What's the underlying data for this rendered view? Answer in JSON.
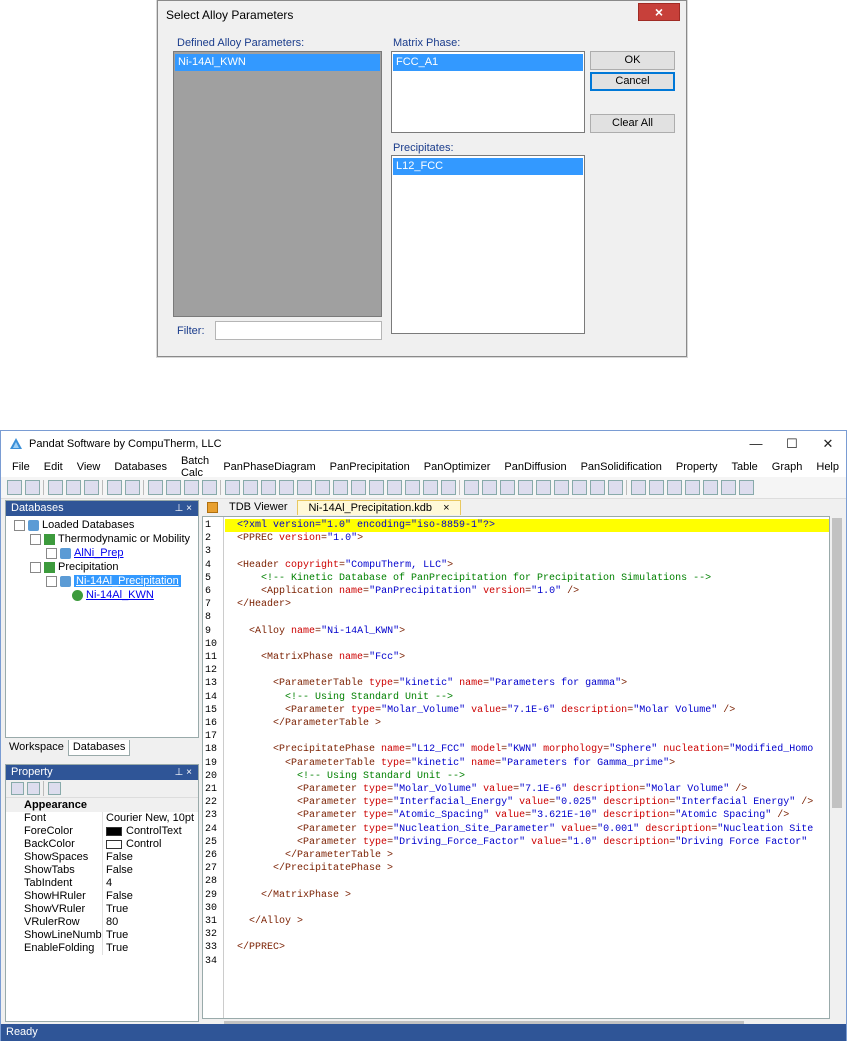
{
  "dialog": {
    "title": "Select Alloy Parameters",
    "close_glyph": "×",
    "defined_label": "Defined Alloy Parameters:",
    "defined_items": [
      "Ni-14Al_KWN"
    ],
    "matrix_label": "Matrix Phase:",
    "matrix_items": [
      "FCC_A1"
    ],
    "precip_label": "Precipitates:",
    "precip_items": [
      "L12_FCC"
    ],
    "filter_label": "Filter:",
    "filter_value": "",
    "ok_label": "OK",
    "cancel_label": "Cancel",
    "clear_label": "Clear All"
  },
  "window": {
    "title": "Pandat Software by CompuTherm, LLC",
    "minimize": "—",
    "maximize": "☐",
    "close": "✕",
    "menu": [
      "File",
      "Edit",
      "View",
      "Databases",
      "Batch Calc",
      "PanPhaseDiagram",
      "PanPrecipitation",
      "PanOptimizer",
      "PanDiffusion",
      "PanSolidification",
      "Property",
      "Table",
      "Graph",
      "Help"
    ]
  },
  "databases_panel": {
    "title": "Databases",
    "pin": "⊥ ×",
    "tree": {
      "root": "Loaded Databases",
      "thermo": "Thermodynamic or Mobility",
      "thermo_child": "AlNi_Prep",
      "precip": "Precipitation",
      "precip_child": "Ni-14Al_Precipitation",
      "precip_grandchild": "Ni-14Al_KWN"
    },
    "tabs": [
      "Workspace",
      "Databases"
    ]
  },
  "property_panel": {
    "title": "Property",
    "pin": "⊥ ×",
    "category": "Appearance",
    "rows": [
      {
        "name": "Font",
        "value": "Courier New, 10pt"
      },
      {
        "name": "ForeColor",
        "value": "ControlText"
      },
      {
        "name": "BackColor",
        "value": "Control"
      },
      {
        "name": "ShowSpaces",
        "value": "False"
      },
      {
        "name": "ShowTabs",
        "value": "False"
      },
      {
        "name": "TabIndent",
        "value": "4"
      },
      {
        "name": "ShowHRuler",
        "value": "False"
      },
      {
        "name": "ShowVRuler",
        "value": "True"
      },
      {
        "name": "VRulerRow",
        "value": "80"
      },
      {
        "name": "ShowLineNumbe",
        "value": "True"
      },
      {
        "name": "EnableFolding",
        "value": "True"
      }
    ]
  },
  "editor": {
    "tabs": [
      "TDB Viewer",
      "Ni-14Al_Precipitation.kdb"
    ],
    "lines": [
      "<?xml version=\"1.0\" encoding=\"iso-8859-1\"?>",
      "<PPREC version=\"1.0\">",
      "",
      "<Header copyright=\"CompuTherm, LLC\">",
      "    <!-- Kinetic Database of PanPrecipitation for Precipitation Simulations -->",
      "    <Application name=\"PanPrecipitation\" version=\"1.0\" />",
      "</Header>",
      "",
      "  <Alloy name=\"Ni-14Al_KWN\">",
      "",
      "    <MatrixPhase name=\"Fcc\">",
      "",
      "      <ParameterTable type=\"kinetic\" name=\"Parameters for gamma\">",
      "        <!-- Using Standard Unit -->",
      "        <Parameter type=\"Molar_Volume\" value=\"7.1E-6\" description=\"Molar Volume\" />",
      "      </ParameterTable >",
      "",
      "      <PrecipitatePhase name=\"L12_FCC\" model=\"KWN\" morphology=\"Sphere\" nucleation=\"Modified_Homo",
      "        <ParameterTable type=\"kinetic\" name=\"Parameters for Gamma_prime\">",
      "          <!-- Using Standard Unit -->",
      "          <Parameter type=\"Molar_Volume\" value=\"7.1E-6\" description=\"Molar Volume\" />",
      "          <Parameter type=\"Interfacial_Energy\" value=\"0.025\" description=\"Interfacial Energy\" />",
      "          <Parameter type=\"Atomic_Spacing\" value=\"3.621E-10\" description=\"Atomic Spacing\" />",
      "          <Parameter type=\"Nucleation_Site_Parameter\" value=\"0.001\" description=\"Nucleation Site",
      "          <Parameter type=\"Driving_Force_Factor\" value=\"1.0\" description=\"Driving Force Factor\" ",
      "        </ParameterTable >",
      "      </PrecipitatePhase >",
      "",
      "    </MatrixPhase >",
      "",
      "  </Alloy >",
      "",
      "</PPREC>",
      ""
    ]
  },
  "status": "Ready",
  "colors": {
    "selection": "#3399ff",
    "panel_header": "#2f5597",
    "line_highlight": "#ffff00"
  }
}
